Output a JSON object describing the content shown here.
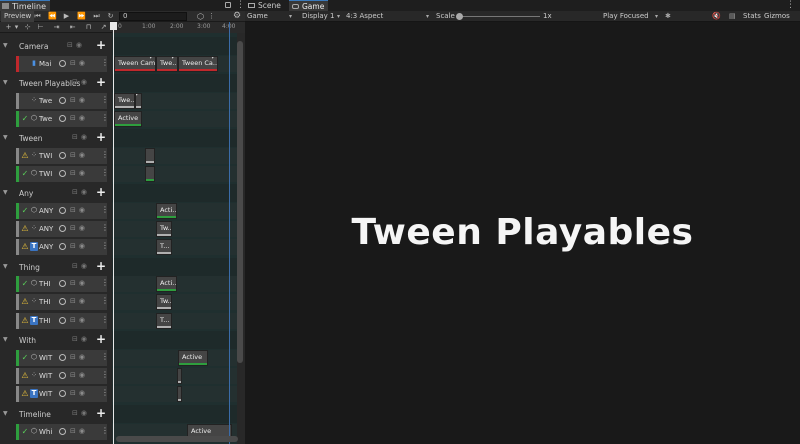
{
  "timeline": {
    "window_tab": "Timeline",
    "preview_label": "Preview",
    "frame_value": "0",
    "ruler_ticks": [
      "0",
      "1:00",
      "2:00",
      "3:00",
      "4:00"
    ],
    "groups": [
      {
        "name": "Camera"
      },
      {
        "name": "Tween Playables"
      },
      {
        "name": "Tween"
      },
      {
        "name": "Any"
      },
      {
        "name": "Thing"
      },
      {
        "name": "With"
      },
      {
        "name": "Timeline"
      }
    ],
    "tracks": [
      {
        "name": "Mai",
        "status": "none",
        "icon": "camera"
      },
      {
        "name": "Twe",
        "status": "none",
        "icon": "dots"
      },
      {
        "name": "Twe",
        "status": "check",
        "icon": "cube"
      },
      {
        "name": "TWI",
        "status": "warn",
        "icon": "dots"
      },
      {
        "name": "TWI",
        "status": "check",
        "icon": "cube"
      },
      {
        "name": "ANY",
        "status": "check",
        "icon": "cube"
      },
      {
        "name": "ANY",
        "status": "warn",
        "icon": "dots"
      },
      {
        "name": "ANY",
        "status": "warn",
        "icon": "T"
      },
      {
        "name": "THI",
        "status": "check",
        "icon": "cube"
      },
      {
        "name": "THI",
        "status": "warn",
        "icon": "dots"
      },
      {
        "name": "THI",
        "status": "warn",
        "icon": "T"
      },
      {
        "name": "WIT",
        "status": "check",
        "icon": "cube"
      },
      {
        "name": "WIT",
        "status": "warn",
        "icon": "dots"
      },
      {
        "name": "WIT",
        "status": "warn",
        "icon": "T"
      },
      {
        "name": "Whi",
        "status": "check",
        "icon": "cube"
      }
    ],
    "clips": {
      "camera_1": "Tween Cam...",
      "camera_2": "Twe...",
      "camera_3": "Tween Ca...",
      "playables_1": "Twe...",
      "playables_active": "Active",
      "any_active": "Acti...",
      "any_tw": "Tw...",
      "any_t": "T...",
      "thing_active": "Acti...",
      "thing_tw": "Tw...",
      "thing_t": "T...",
      "with_active": "Active",
      "timeline_active": "Active"
    }
  },
  "game": {
    "tabs": [
      "Scene",
      "Game"
    ],
    "display_mode": "Game",
    "display": "Display 1",
    "aspect": "4:3 Aspect",
    "scale_label": "Scale",
    "scale_value": "1x",
    "play_mode": "Play Focused",
    "stats": "Stats",
    "gizmos": "Gizmos",
    "title_text": "Tween Playables"
  },
  "colors": {
    "active_bar": "#2e9e3e",
    "camera_bar": "#c0282c",
    "neutral_bar": "#b0b0b0",
    "check": "#5ad15a",
    "warn": "#e9c13a"
  }
}
